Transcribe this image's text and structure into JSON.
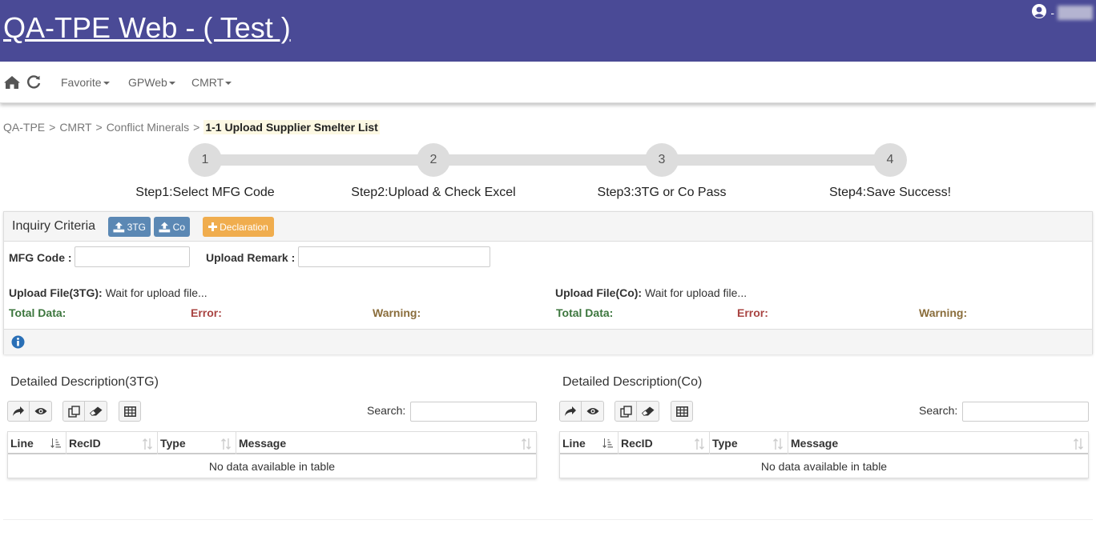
{
  "header": {
    "title": "QA-TPE Web - ( Test )",
    "user_dash": "-",
    "bg_color": "#4a4a96"
  },
  "nav": {
    "home_icon": "home-icon",
    "refresh_icon": "refresh-icon",
    "items": [
      "Favorite",
      "GPWeb",
      "CMRT"
    ]
  },
  "breadcrumb": {
    "items": [
      "QA-TPE",
      "CMRT",
      "Conflict Minerals"
    ],
    "separator": ">",
    "current": "1-1 Upload Supplier Smelter List"
  },
  "steps": [
    {
      "number": "1",
      "label": "Step1:Select MFG Code"
    },
    {
      "number": "2",
      "label": "Step2:Upload & Check Excel"
    },
    {
      "number": "3",
      "label": "Step3:3TG or Co Pass"
    },
    {
      "number": "4",
      "label": "Step4:Save Success!"
    }
  ],
  "inquiry": {
    "title": "Inquiry Criteria",
    "btn_3tg": "3TG",
    "btn_co": "Co",
    "btn_declaration": "Declaration",
    "mfg_label": "MFG Code :",
    "mfg_value": "",
    "remark_label": "Upload Remark :",
    "remark_value": "",
    "file_3tg_label": "Upload File(3TG):",
    "file_3tg_status": "Wait for upload file...",
    "file_co_label": "Upload File(Co):",
    "file_co_status": "Wait for upload file...",
    "total_label": "Total Data:",
    "error_label": "Error:",
    "warning_label": "Warning:"
  },
  "detail_3tg": {
    "title": "Detailed Description(3TG)",
    "search_label": "Search:",
    "search_value": "",
    "columns": [
      "Line",
      "RecID",
      "Type",
      "Message"
    ],
    "empty_text": "No data available in table"
  },
  "detail_co": {
    "title": "Detailed Description(Co)",
    "search_label": "Search:",
    "search_value": "",
    "columns": [
      "Line",
      "RecID",
      "Type",
      "Message"
    ],
    "empty_text": "No data available in table"
  }
}
